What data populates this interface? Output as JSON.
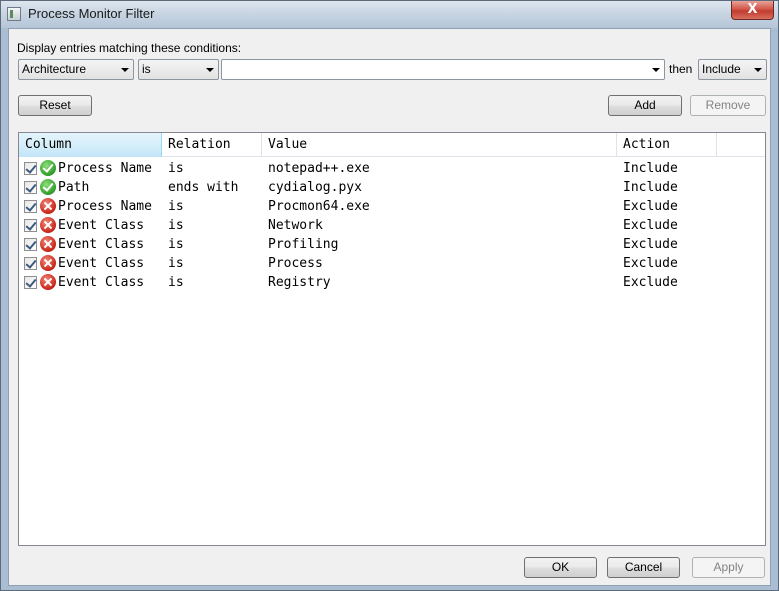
{
  "window": {
    "title": "Process Monitor Filter",
    "close_glyph": "X"
  },
  "conditions": {
    "label": "Display entries matching these conditions:",
    "column_value": "Architecture",
    "relation_value": "is",
    "value_text": "",
    "then_label": "then",
    "action_value": "Include"
  },
  "buttons": {
    "reset": "Reset",
    "add": "Add",
    "remove": "Remove",
    "ok": "OK",
    "cancel": "Cancel",
    "apply": "Apply"
  },
  "table": {
    "headers": [
      "Column",
      "Relation",
      "Value",
      "Action"
    ],
    "rows": [
      {
        "checked": true,
        "status": "include-icon",
        "column": "Process Name",
        "relation": "is",
        "value": "notepad++.exe",
        "action": "Include"
      },
      {
        "checked": true,
        "status": "include-icon",
        "column": "Path",
        "relation": "ends with",
        "value": "cydialog.pyx",
        "action": "Include"
      },
      {
        "checked": true,
        "status": "exclude-icon",
        "column": "Process Name",
        "relation": "is",
        "value": "Procmon64.exe",
        "action": "Exclude"
      },
      {
        "checked": true,
        "status": "exclude-icon",
        "column": "Event Class",
        "relation": "is",
        "value": "Network",
        "action": "Exclude"
      },
      {
        "checked": true,
        "status": "exclude-icon",
        "column": "Event Class",
        "relation": "is",
        "value": "Profiling",
        "action": "Exclude"
      },
      {
        "checked": true,
        "status": "exclude-icon",
        "column": "Event Class",
        "relation": "is",
        "value": "Process",
        "action": "Exclude"
      },
      {
        "checked": true,
        "status": "exclude-icon",
        "column": "Event Class",
        "relation": "is",
        "value": "Registry",
        "action": "Exclude"
      }
    ]
  },
  "colors": {
    "include": "#2f9a2a",
    "exclude": "#cc2a1c",
    "sorted_header": "#d6eefa"
  }
}
